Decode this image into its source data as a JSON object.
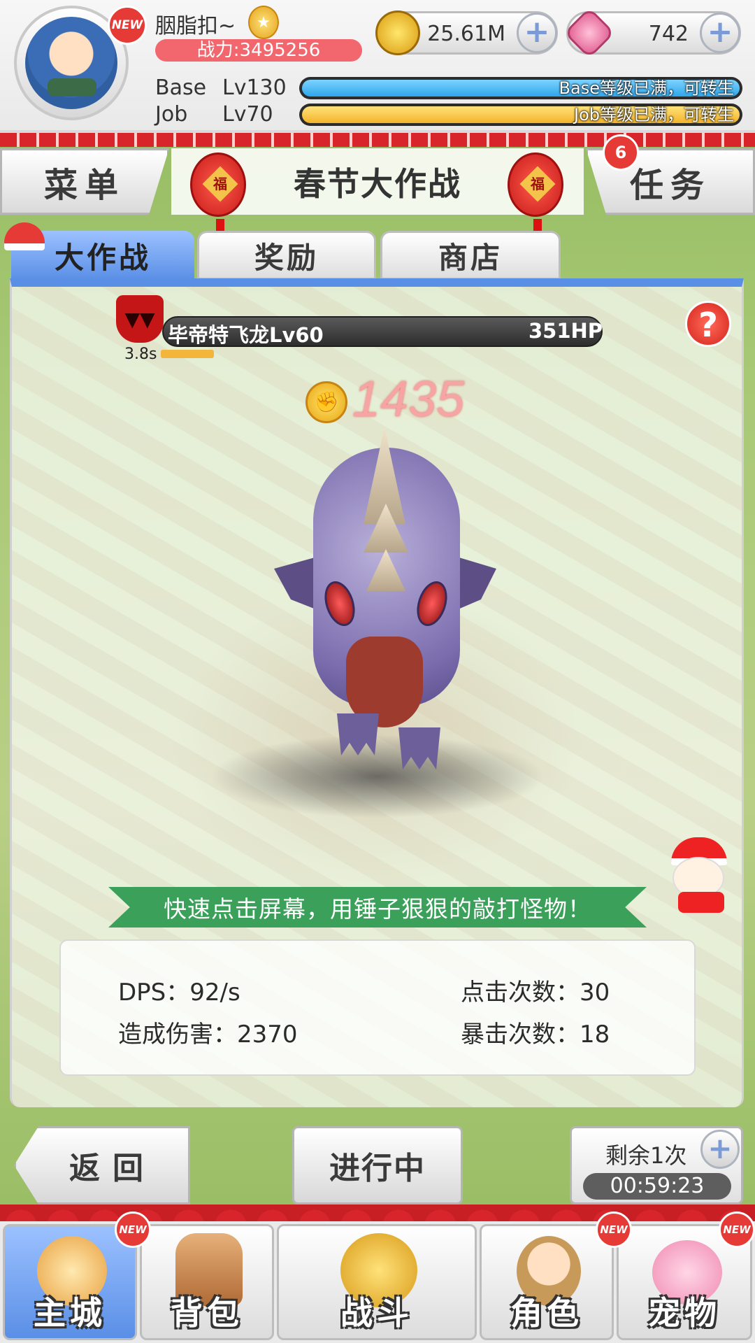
{
  "player": {
    "name": "胭脂扣~",
    "power": "战力:3495256",
    "avatar_badge": "NEW",
    "base_label": "Base",
    "base_level": "Lv130",
    "base_bar_text": "Base等级已满，可转生",
    "job_label": "Job",
    "job_level": "Lv70",
    "job_bar_text": "Job等级已满，可转生"
  },
  "currency": {
    "zeny": "25.61M",
    "gems": "742",
    "plus": "+"
  },
  "header": {
    "menu_label": "菜单",
    "event_title": "春节大作战",
    "task_label": "任务",
    "task_badge": "6",
    "lantern_char": "福"
  },
  "tabs": [
    {
      "label": "大作战"
    },
    {
      "label": "奖励"
    },
    {
      "label": "商店"
    }
  ],
  "boss": {
    "name": "毕帝特飞龙Lv60",
    "hp": "351HP",
    "timer": "3.8s",
    "help": "?"
  },
  "score": {
    "value": "1435"
  },
  "tip": "快速点击屏幕，用锤子狠狠的敲打怪物！",
  "stats": {
    "dps": "DPS：92/s",
    "clicks": "点击次数：30",
    "damage": "造成伤害：2370",
    "crits": "暴击次数：18"
  },
  "controls": {
    "back_label": "返回",
    "status_label": "进行中",
    "remain_label": "剩余1次",
    "timer": "00:59:23",
    "plus": "+"
  },
  "nav": [
    {
      "label": "主城",
      "badge": "NEW"
    },
    {
      "label": "背包",
      "badge": ""
    },
    {
      "label": "战斗",
      "badge": ""
    },
    {
      "label": "角色",
      "badge": "NEW"
    },
    {
      "label": "宠物",
      "badge": "NEW"
    }
  ],
  "colors": {
    "accent_blue": "#5a8fe6",
    "power_red": "#f2676d",
    "tip_green": "#3aa05a",
    "base_bar": "#2fa6ea",
    "job_bar": "#f6c23a"
  }
}
